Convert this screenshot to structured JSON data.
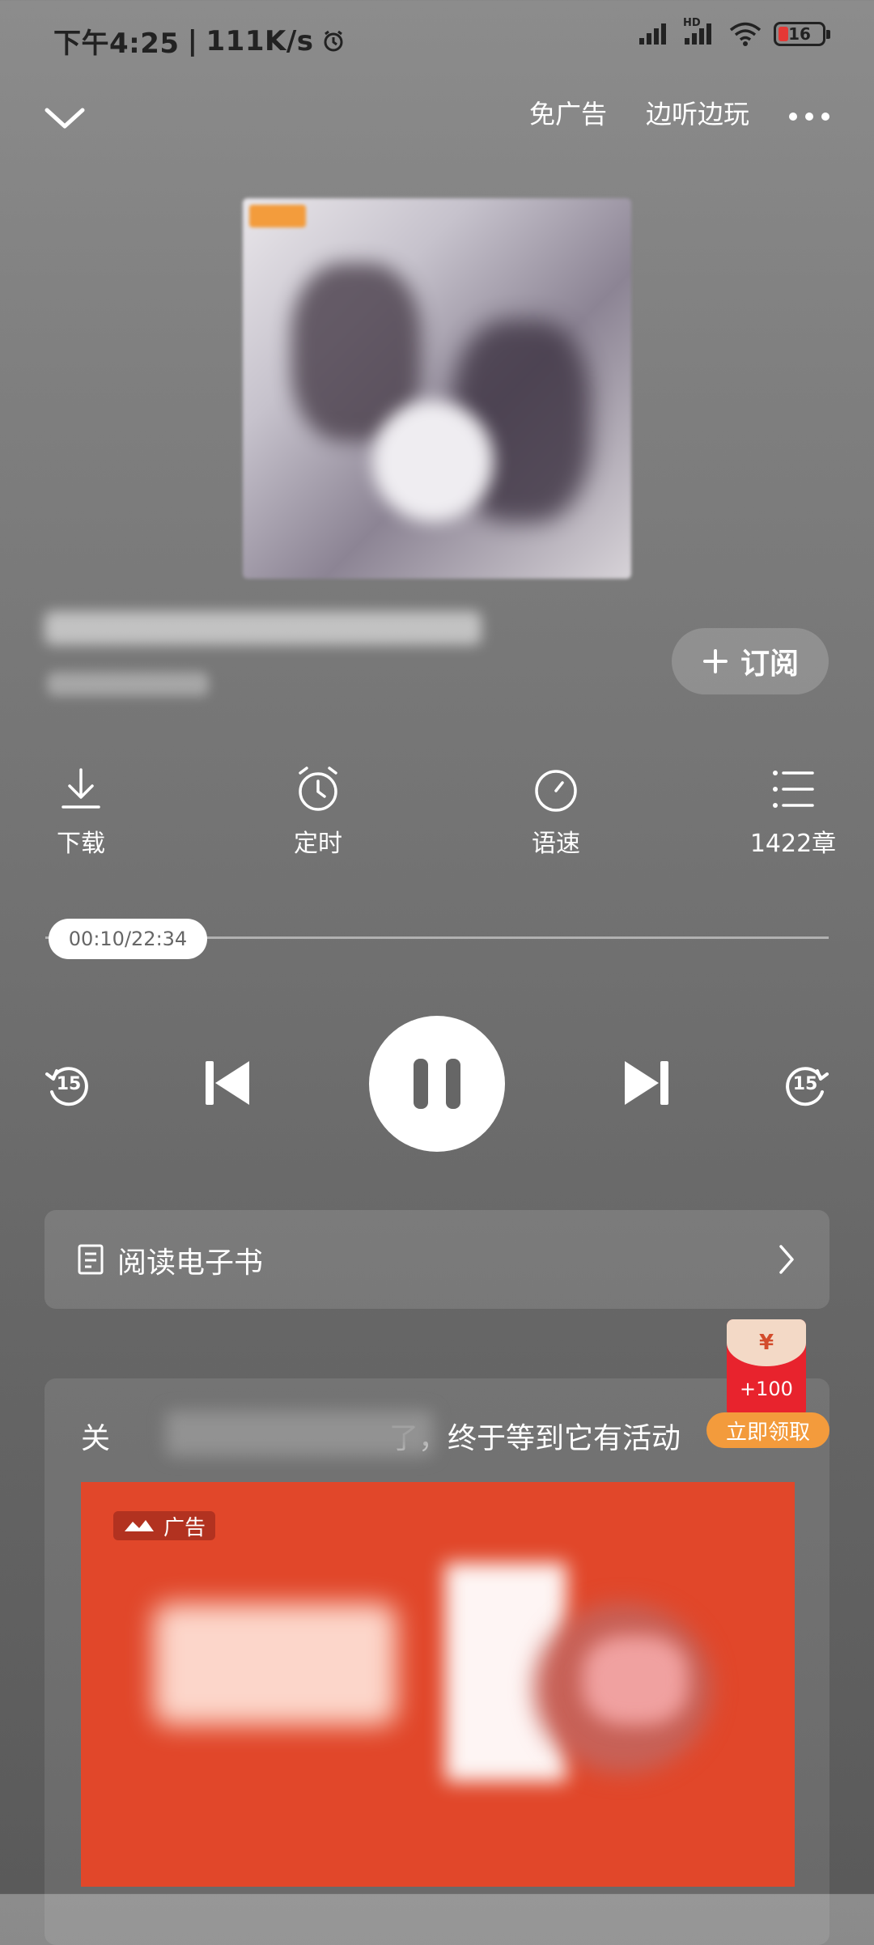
{
  "status_bar": {
    "time": "下午4:25",
    "speed": "111K/s",
    "network_badge": "HD",
    "battery": "16"
  },
  "topbar": {
    "ad_free": "免广告",
    "listen_and_play": "边听边玩"
  },
  "subscribe_label": "订阅",
  "actions": {
    "download": "下载",
    "timer": "定时",
    "speed": "语速",
    "chapters": "1422章"
  },
  "player": {
    "time_display": "00:10/22:34",
    "rewind_seconds": "15",
    "forward_seconds": "15",
    "progress_fraction": 0.007
  },
  "ebook_label": "阅读电子书",
  "promo": {
    "text_before": "关",
    "text_after": "了，终于等到它有活动",
    "ad_tag": "广告",
    "red_packet_amount": "+100",
    "claim_label": "立即领取",
    "red_packet_symbol": "¥"
  },
  "colors": {
    "accent_orange": "#f39b3c",
    "red_packet": "#e8232d",
    "ad_background": "#e1472a"
  }
}
